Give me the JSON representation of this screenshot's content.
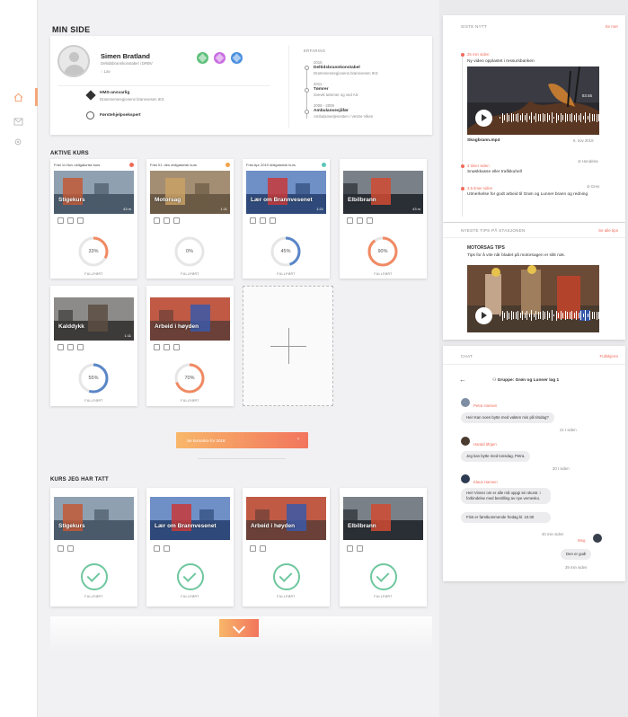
{
  "sidebar": {
    "icons": [
      "home-icon",
      "mail-icon",
      "gear-icon"
    ]
  },
  "page": {
    "title": "MIN SIDE"
  },
  "profile": {
    "name": "Simen Bratland",
    "role": "Deltidsbrannkonstabel i DRBV",
    "status": "Lav",
    "qualifications": [
      {
        "title": "HMS-ansvarlig",
        "sub": "Drammensregionens brannvesen IKS"
      },
      {
        "title": "Førstehjelpsekspert",
        "sub": ""
      }
    ],
    "badge_colors": [
      "#5fbf7a",
      "#c86de0",
      "#4a8fe0"
    ],
    "experience_header": "ERFARING",
    "experience": [
      {
        "years": "2015",
        "title": "Deltidsbrannkonstabel",
        "org": "Drammensregionens brannvesen IKS"
      },
      {
        "years": "2011 -",
        "title": "Tømrer",
        "org": "Svevik tømmer og ved AS"
      },
      {
        "years": "2008 - 2009",
        "title": "Ambulansesjåfør",
        "org": "Ambulansetjenesten i Vestre Viken"
      }
    ]
  },
  "active_courses": {
    "header": "AKTIVE KURS",
    "items": [
      {
        "head": "Frist 11.Nov obligatorisk kurs",
        "title": "Stigekurs",
        "dur": "43 m",
        "pct": 33,
        "pct_label": "33%",
        "foot": "FULLFØRT",
        "color": "#f06b5a"
      },
      {
        "head": "Frist 01. des obligatorisk kurs",
        "title": "Motorsag",
        "dur": "1:11",
        "pct": 0,
        "pct_label": "0%",
        "foot": "FULLFØRT",
        "color": "#f2a24a"
      },
      {
        "head": "Frist Apr 2019 obligatorisk kurs",
        "title": "Lær om Brannvesenet",
        "dur": "1:21",
        "pct": 45,
        "pct_label": "45%",
        "foot": "FULLFØRT",
        "color": "#5bc6b8"
      },
      {
        "head": "",
        "title": "Elbilbrann",
        "dur": "43 m",
        "pct": 90,
        "pct_label": "90%",
        "foot": "FULLFØRT",
        "color": ""
      },
      {
        "head": "",
        "title": "Kalddykk",
        "dur": "1:11",
        "pct": 55,
        "pct_label": "55%",
        "foot": "FULLFØRT",
        "color": ""
      },
      {
        "head": "",
        "title": "Arbeid i høyden",
        "dur": "",
        "pct": 70,
        "pct_label": "70%",
        "foot": "FULLFØRT",
        "color": ""
      }
    ]
  },
  "archive_button": "Se kursarkiv for 2018",
  "completed_courses": {
    "header": "KURS JEG HAR TATT",
    "items": [
      {
        "title": "Stigekurs",
        "foot": "FULLFØRT"
      },
      {
        "title": "Lær om Brannvesenet",
        "foot": "FULLFØRT"
      },
      {
        "title": "Arbeid i høyden",
        "foot": "FULLFØRT"
      },
      {
        "title": "Elbilbrann",
        "foot": "FULLFØRT"
      }
    ]
  },
  "news": {
    "header": "SISTE NYTT",
    "link": "Se mer",
    "items": [
      {
        "time": "25 min siden",
        "text": "Ny video opplastet i ressursbanken",
        "file": "Skogbrann.mp4",
        "date": "6. nov 2018",
        "dot": "#f06b5a",
        "video_dur": "03:45"
      },
      {
        "time": "3 timer siden",
        "text": "Snøskkasse eller trafikkuhell",
        "tag": "Hendelse",
        "dot": "#f06b5a"
      },
      {
        "time": "3,5 timer siden",
        "text": "Utmerkelse for godt arbeid til Grøn og Lunner brann og redning",
        "tag": "Gren",
        "dot": "#f06b5a"
      }
    ]
  },
  "tips": {
    "header": "NYESTE TIPS PÅ STASJONEN",
    "link": "Se alle tips",
    "title": "MOTORSAG TIPS",
    "text": "Tips for å vite når bladet på motorsagen er slitt nok."
  },
  "chat": {
    "header": "CHAT",
    "link": "Fullskjerm",
    "group": "Gruppe: Grøn og Lunner lag 1",
    "messages": [
      {
        "name": "Petra Hansen",
        "text": "Hei! Kan noen bytte med vakten min på tirsdag?",
        "time": "21 t siden"
      },
      {
        "name": "Harald Ørgen",
        "text": "Jeg kan bytte med tonsdag, Petra.",
        "time": "20 t siden"
      },
      {
        "name": "Klaus Hansen",
        "text": "Hei! Vinner om er alle må oppgi sin skostr. i forbindelse med bestilling av nye vernesko.",
        "text2": "Frist er førstkommende fredag kl. 10.00",
        "time": "40 min siden"
      },
      {
        "name": "Meg",
        "text": "Den er god!",
        "time": "39 min siden"
      }
    ]
  }
}
